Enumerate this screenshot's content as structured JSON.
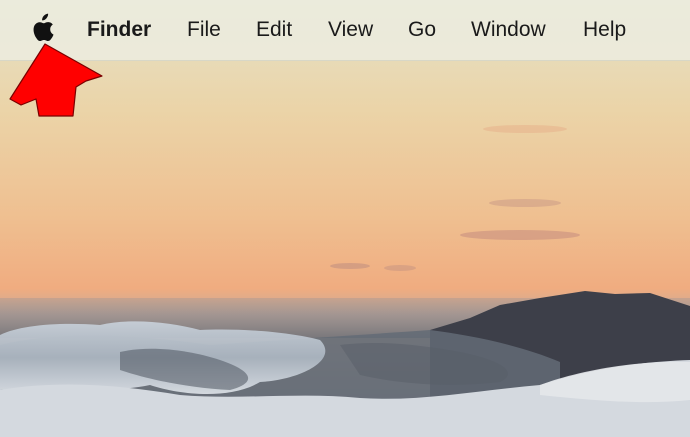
{
  "menubar": {
    "apple_icon": "apple-logo-icon",
    "items": [
      {
        "label": "Finder",
        "bold": true
      },
      {
        "label": "File"
      },
      {
        "label": "Edit"
      },
      {
        "label": "View"
      },
      {
        "label": "Go"
      },
      {
        "label": "Window"
      },
      {
        "label": "Help"
      }
    ]
  },
  "annotation": {
    "icon": "red-arrow-icon",
    "color": "#ff0000"
  },
  "colors": {
    "menubar_bg": "#ececde",
    "menu_text": "#1a1a1a",
    "sky_top": "#e7e2c6",
    "sky_mid": "#eec592",
    "sky_low": "#f0ad80"
  }
}
